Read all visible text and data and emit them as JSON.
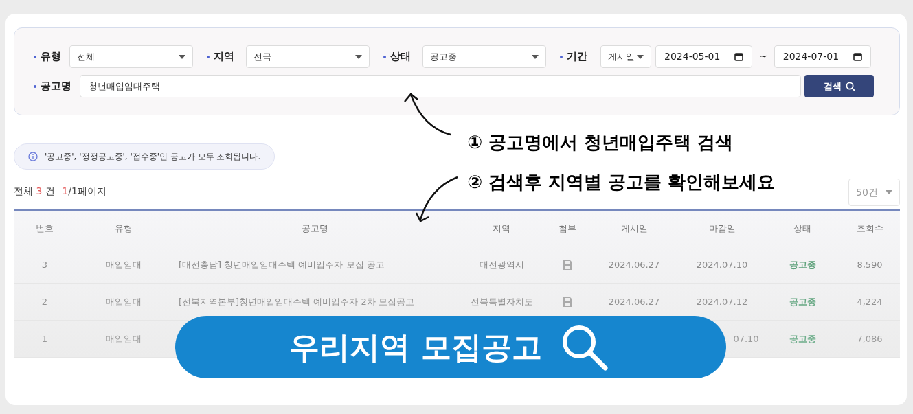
{
  "filters": [
    {
      "kind": "select",
      "label": "유형",
      "value": "전체"
    },
    {
      "kind": "select",
      "label": "지역",
      "value": "전국"
    },
    {
      "kind": "select",
      "label": "상태",
      "value": "공고중"
    },
    {
      "kind": "period",
      "label": "기간",
      "basis": "게시일",
      "from": "2024-05-01",
      "separator": "~",
      "to": "2024-07-01"
    }
  ],
  "title_filter": {
    "label": "공고명",
    "value": "청년매입임대주택"
  },
  "search_button": "검색",
  "annotations": [
    {
      "text": "① 공고명에서 청년매입주택 검색"
    },
    {
      "text": "② 검색후 지역별 공고를 확인해보세요"
    }
  ],
  "notice": "'공고중', '정정공고중', '접수중'인 공고가 모두 조회됩니다.",
  "summary": {
    "total_label": "전체",
    "total": "3",
    "unit": "건",
    "page": "1",
    "pages": "/1페이지"
  },
  "page_size": "50건",
  "table": {
    "columns": [
      "번호",
      "유형",
      "공고명",
      "지역",
      "첨부",
      "게시일",
      "마감일",
      "상태",
      "조회수"
    ],
    "rows": [
      {
        "number": "3",
        "type": "매입임대",
        "title": "[대전충남] 청년매입임대주택 예비입주자 모집 공고",
        "region": "대전광역시",
        "attachment": true,
        "posted": "2024.06.27",
        "deadline": "2024.07.10",
        "status": "공고중",
        "views": "8,590"
      },
      {
        "number": "2",
        "type": "매입임대",
        "title": "[전북지역본부]청년매입임대주택 예비입주자 2차 모집공고",
        "region": "전북특별자치도",
        "attachment": true,
        "posted": "2024.06.27",
        "deadline": "2024.07.12",
        "status": "공고중",
        "views": "4,224"
      },
      {
        "number": "1",
        "type": "매입임대",
        "deadline": "07.10",
        "status": "공고중",
        "views": "7,086"
      }
    ]
  },
  "banner": "우리지역 모집공고"
}
